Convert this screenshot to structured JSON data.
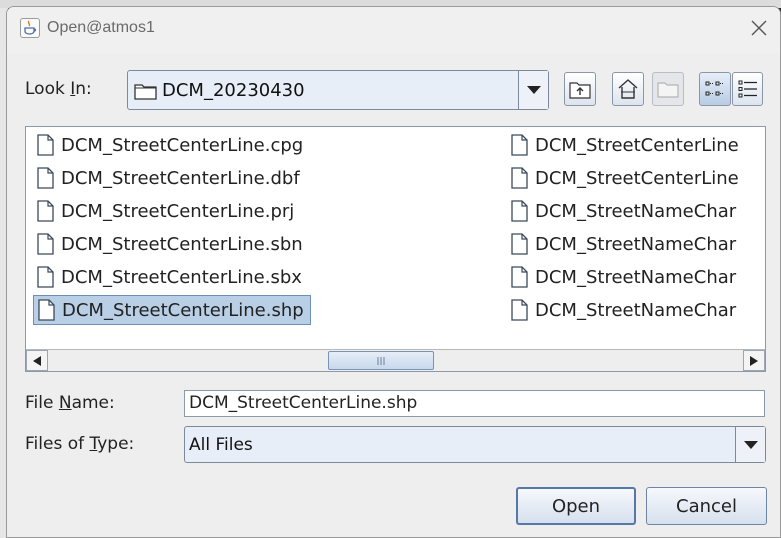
{
  "window": {
    "title": "Open@atmos1",
    "icon": "java-cup-icon",
    "close_icon": "close-icon"
  },
  "look_in": {
    "label_pre": "Look ",
    "label_mnemonic": "I",
    "label_post": "n:",
    "value": "DCM_20230430",
    "icon": "folder-icon"
  },
  "toolbar": {
    "buttons": [
      {
        "name": "up-one-level",
        "icon": "folder-up-icon",
        "enabled": true
      },
      {
        "name": "home",
        "icon": "home-icon",
        "enabled": true
      },
      {
        "name": "new-folder",
        "icon": "new-folder-icon",
        "enabled": false
      },
      {
        "name": "list-view",
        "icon": "list-view-icon",
        "enabled": true,
        "active": true
      },
      {
        "name": "details-view",
        "icon": "details-view-icon",
        "enabled": true
      }
    ]
  },
  "files": {
    "column1": [
      {
        "name": "DCM_StreetCenterLine.cpg",
        "selected": false
      },
      {
        "name": "DCM_StreetCenterLine.dbf",
        "selected": false
      },
      {
        "name": "DCM_StreetCenterLine.prj",
        "selected": false
      },
      {
        "name": "DCM_StreetCenterLine.sbn",
        "selected": false
      },
      {
        "name": "DCM_StreetCenterLine.sbx",
        "selected": false
      },
      {
        "name": "DCM_StreetCenterLine.shp",
        "selected": true
      }
    ],
    "column2": [
      {
        "name": "DCM_StreetCenterLine",
        "selected": false
      },
      {
        "name": "DCM_StreetCenterLine",
        "selected": false
      },
      {
        "name": "DCM_StreetNameChar",
        "selected": false
      },
      {
        "name": "DCM_StreetNameChar",
        "selected": false
      },
      {
        "name": "DCM_StreetNameChar",
        "selected": false
      },
      {
        "name": "DCM_StreetNameChar",
        "selected": false
      }
    ],
    "file_icon": "file-icon"
  },
  "file_name": {
    "label_pre": "File ",
    "label_mnemonic": "N",
    "label_post": "ame:",
    "value": "DCM_StreetCenterLine.shp"
  },
  "file_type": {
    "label_pre": "Files of ",
    "label_mnemonic": "T",
    "label_post": "ype:",
    "value": "All Files"
  },
  "buttons": {
    "open": "Open",
    "cancel": "Cancel"
  }
}
